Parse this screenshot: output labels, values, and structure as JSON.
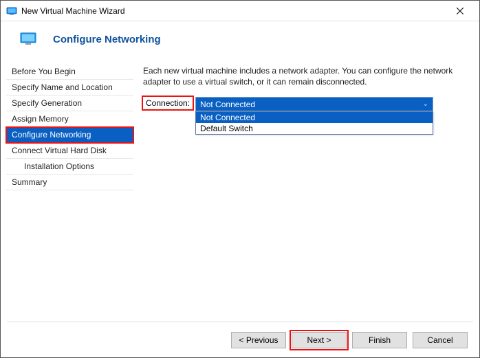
{
  "window": {
    "title": "New Virtual Machine Wizard"
  },
  "header": {
    "title": "Configure Networking"
  },
  "sidebar": {
    "items": [
      {
        "label": "Before You Begin"
      },
      {
        "label": "Specify Name and Location"
      },
      {
        "label": "Specify Generation"
      },
      {
        "label": "Assign Memory"
      },
      {
        "label": "Configure Networking"
      },
      {
        "label": "Connect Virtual Hard Disk"
      },
      {
        "label": "Installation Options"
      },
      {
        "label": "Summary"
      }
    ]
  },
  "main": {
    "description": "Each new virtual machine includes a network adapter. You can configure the network adapter to use a virtual switch, or it can remain disconnected.",
    "connection_label": "Connection:",
    "connection_selected": "Not Connected",
    "connection_options": [
      "Not Connected",
      "Default Switch"
    ]
  },
  "footer": {
    "previous": "< Previous",
    "next": "Next >",
    "finish": "Finish",
    "cancel": "Cancel"
  }
}
